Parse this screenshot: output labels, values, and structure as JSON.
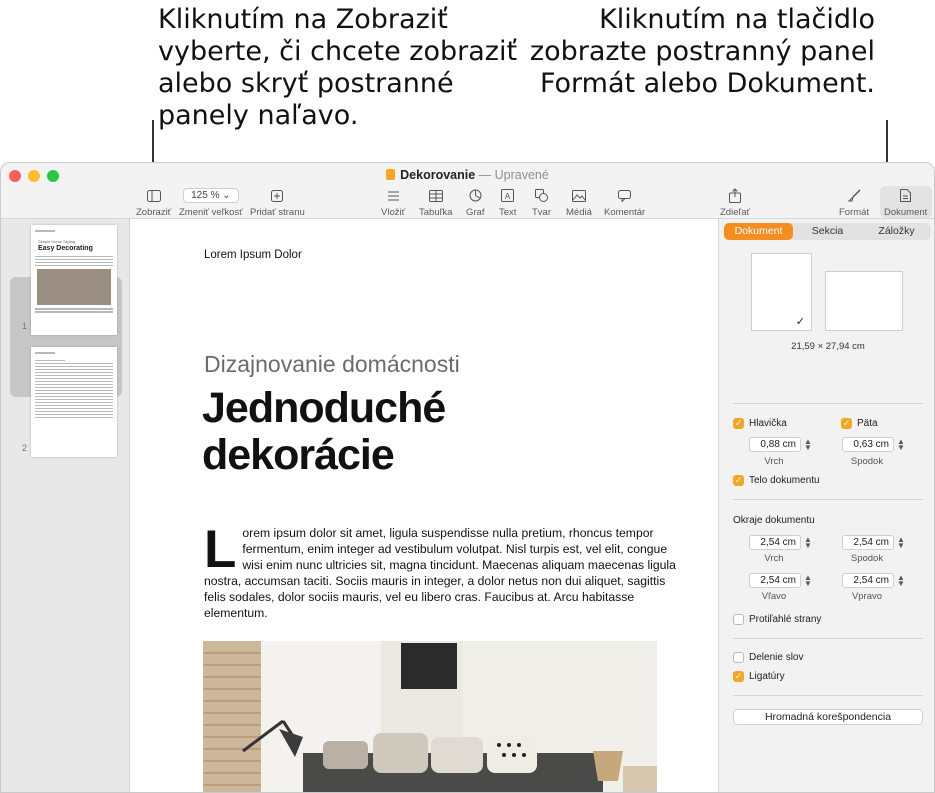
{
  "callouts": {
    "left": "Kliknutím na Zobraziť vyberte, či chcete zobraziť alebo skryť postranné panely naľavo.",
    "right": "Kliknutím na tlačidlo zobrazte postranný panel Formát alebo Dokument."
  },
  "window": {
    "title": "Dekorovanie",
    "title_separator": "—",
    "status": "Upravené"
  },
  "toolbar": {
    "view_label": "Zobraziť",
    "zoom_value": "125 %",
    "zoom_label": "Zmeniť veľkosť",
    "add_page_label": "Pridať stranu",
    "insert_label": "Vložiť",
    "table_label": "Tabuľka",
    "chart_label": "Graf",
    "text_label": "Text",
    "shape_label": "Tvar",
    "media_label": "Médiá",
    "comment_label": "Komentár",
    "share_label": "Zdieľať",
    "format_label": "Formát",
    "document_label": "Dokument"
  },
  "sidebar": {
    "pages": [
      {
        "number": "1",
        "thumb_subtitle": "Simple Home Styling",
        "thumb_title": "Easy Decorating"
      },
      {
        "number": "2"
      }
    ]
  },
  "document": {
    "header": "Lorem Ipsum Dolor",
    "subtitle": "Dizajnovanie domácnosti",
    "title": "Jednoduché dekorácie",
    "drop_cap": "L",
    "body": "orem ipsum dolor sit amet, ligula suspendisse nulla pretium, rhoncus tempor fermentum, enim integer ad vestibulum volutpat. Nisl turpis est, vel elit, congue wisi enim nunc ultricies sit, magna tincidunt. Maecenas aliquam maecenas ligula nostra, accumsan taciti. Sociis mauris in integer, a dolor netus non dui aliquet, sagittis felis sodales, dolor sociis mauris, vel eu libero cras. Faucibus at. Arcu habitasse elementum."
  },
  "inspector": {
    "tabs": [
      "Dokument",
      "Sekcia",
      "Záložky"
    ],
    "active_tab": "Dokument",
    "paper_size": "21,59 × 27,94 cm",
    "header_label": "Hlavička",
    "footer_label": "Päta",
    "header_value": "0,88 cm",
    "footer_value": "0,63 cm",
    "top_label": "Vrch",
    "bottom_label": "Spodok",
    "body_label": "Telo dokumentu",
    "margins_title": "Okraje dokumentu",
    "margin_top": "2,54 cm",
    "margin_bottom": "2,54 cm",
    "margin_left": "2,54 cm",
    "margin_right": "2,54 cm",
    "left_label": "Vľavo",
    "right_label": "Vpravo",
    "facing_label": "Protiľahlé strany",
    "hyphen_label": "Delenie slov",
    "ligatures_label": "Ligatúry",
    "merge_button": "Hromadná korešpondencia",
    "checks": {
      "header": true,
      "footer": true,
      "body": true,
      "facing": false,
      "hyphenation": false,
      "ligatures": true
    }
  },
  "colors": {
    "accent": "#f58d1f",
    "checkbox": "#f5a623",
    "close": "#fe5f57",
    "minimize": "#febc2e",
    "zoom": "#28c840"
  }
}
